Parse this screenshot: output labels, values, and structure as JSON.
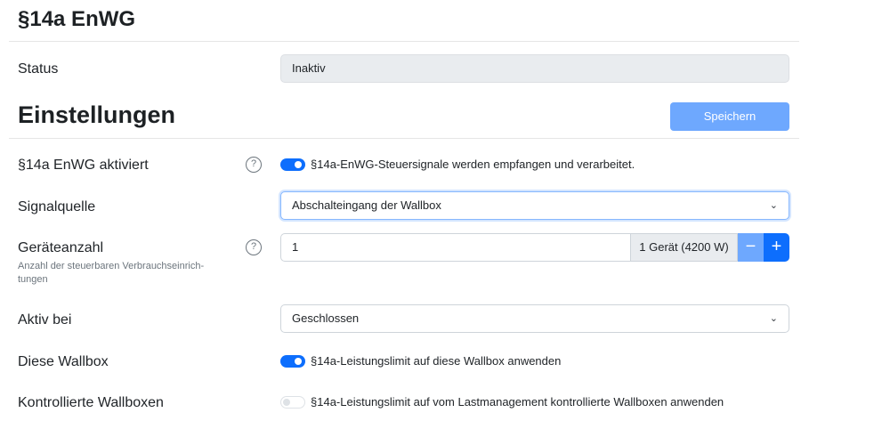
{
  "header": {
    "title": "§14a EnWG"
  },
  "status": {
    "label": "Status",
    "value": "Inaktiv"
  },
  "settings": {
    "title": "Einstellungen",
    "save_label": "Speichern",
    "enabled": {
      "label": "§14a EnWG aktiviert",
      "help": "?",
      "on": true,
      "switch_text": "§14a-EnWG-Steuersignale werden empfangen und verarbeitet."
    },
    "signal_source": {
      "label": "Signalquelle",
      "value": "Abschalteingang der Wallbox"
    },
    "device_count": {
      "label": "Geräteanzahl",
      "help": "?",
      "description": "Anzahl der steuerbaren Verbrauchseinrich-tungen",
      "value": "1",
      "unit_text": "1 Gerät (4200 W)",
      "minus": "−",
      "plus": "+"
    },
    "active_when": {
      "label": "Aktiv bei",
      "value": "Geschlossen"
    },
    "this_wallbox": {
      "label": "Diese Wallbox",
      "on": true,
      "switch_text": "§14a-Leistungslimit auf diese Wallbox anwenden"
    },
    "controlled_wallboxes": {
      "label": "Kontrollierte Wallboxen",
      "on": false,
      "switch_text": "§14a-Leistungslimit auf vom Lastmanagement kontrollierte Wallboxen anwenden"
    }
  },
  "icons": {
    "help": "question-circle-icon",
    "dropdown": "chevron-down-icon"
  },
  "colors": {
    "primary": "#0d6efd",
    "primary_disabled": "#6ea8fe",
    "readonly_bg": "#e9ecef"
  }
}
